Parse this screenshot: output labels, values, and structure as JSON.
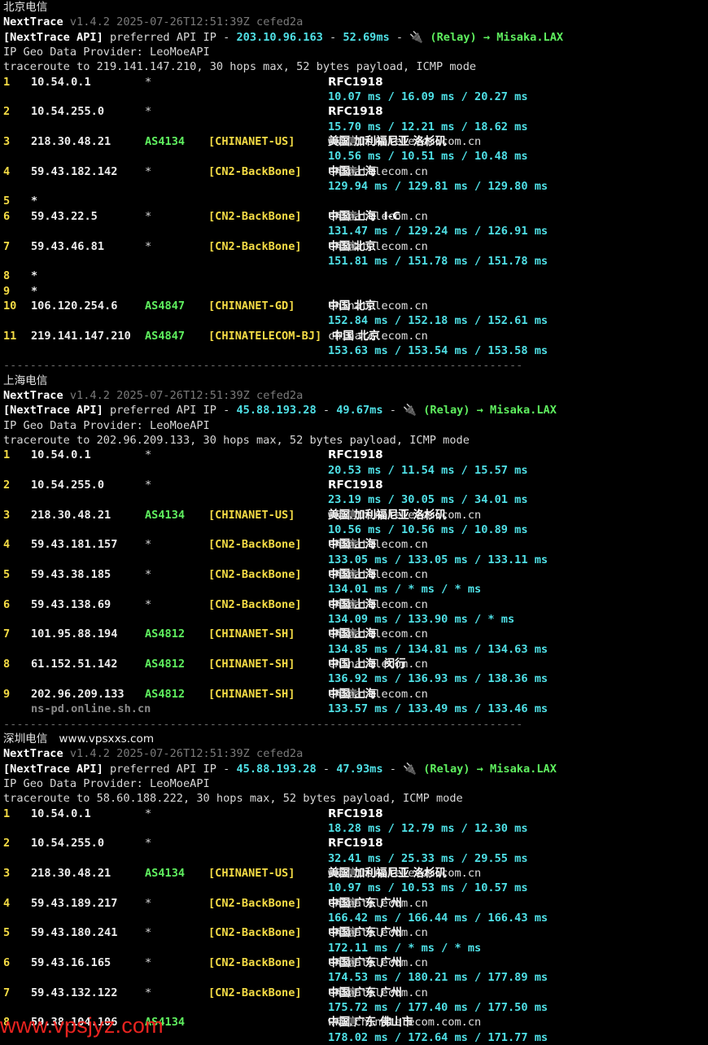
{
  "sections": [
    {
      "title": "北京电信",
      "site": "",
      "version_line": {
        "name": "NextTrace",
        "version": "v1.4.2 2025-07-26T12:51:39Z cefed2a"
      },
      "api_line": {
        "tag": "[NextTrace API]",
        "text1": " preferred API IP - ",
        "ip": "203.10.96.163",
        "dash1": " - ",
        "latency": "52.69ms",
        "dash2": " - ",
        "relay": "🔌 (Relay) → Misaka.LAX"
      },
      "provider_line": "IP Geo Data Provider: LeoMoeAPI",
      "traceroute_line": "traceroute to 219.141.147.210, 30 hops max, 52 bytes payload, ICMP mode",
      "hops": [
        {
          "num": "1",
          "ip": "10.54.0.1",
          "asn": "*",
          "net": "",
          "geo": "RFC1918",
          "domain": "",
          "isp": "",
          "rtt": "10.07 ms / 16.09 ms / 20.27 ms",
          "host": ""
        },
        {
          "num": "2",
          "ip": "10.54.255.0",
          "asn": "*",
          "net": "",
          "geo": "RFC1918",
          "domain": "",
          "isp": "",
          "rtt": "15.70 ms / 12.21 ms / 18.62 ms",
          "host": ""
        },
        {
          "num": "3",
          "ip": "218.30.48.21",
          "asn": "AS4134",
          "net": "[CHINANET-US]",
          "geo": "美国 加利福尼亚 洛杉矶  ",
          "domain": "www.chinatelecom.com.cn",
          "isp": "  电信",
          "rtt": "10.56 ms / 10.51 ms / 10.48 ms",
          "host": ""
        },
        {
          "num": "4",
          "ip": "59.43.182.142",
          "asn": "*",
          "net": "[CN2-BackBone]",
          "geo": "中国 上海    ",
          "domain": "chinatelecom.cn",
          "isp": "  电信",
          "rtt": "129.94 ms / 129.81 ms / 129.80 ms",
          "host": ""
        },
        {
          "num": "5",
          "ip": "*",
          "asn": "",
          "net": "",
          "geo": "",
          "domain": "",
          "isp": "",
          "rtt": "",
          "host": ""
        },
        {
          "num": "6",
          "ip": "59.43.22.5",
          "asn": "*",
          "net": "[CN2-BackBone]",
          "geo": "中国 上海  I-C ",
          "domain": "chinatelecom.cn",
          "isp": "  电信",
          "rtt": "131.47 ms / 129.24 ms / 126.91 ms",
          "host": ""
        },
        {
          "num": "7",
          "ip": "59.43.46.81",
          "asn": "*",
          "net": "[CN2-BackBone]",
          "geo": "中国 北京    ",
          "domain": "chinatelecom.cn",
          "isp": "  电信",
          "rtt": "151.81 ms / 151.78 ms / 151.78 ms",
          "host": ""
        },
        {
          "num": "8",
          "ip": "*",
          "asn": "",
          "net": "",
          "geo": "",
          "domain": "",
          "isp": "",
          "rtt": "",
          "host": ""
        },
        {
          "num": "9",
          "ip": "*",
          "asn": "",
          "net": "",
          "geo": "",
          "domain": "",
          "isp": "",
          "rtt": "",
          "host": ""
        },
        {
          "num": "10",
          "ip": "106.120.254.6",
          "asn": "AS4847",
          "net": "[CHINANET-GD]",
          "geo": "中国 北京    ",
          "domain": "chinatelecom.cn",
          "isp": "",
          "rtt": "152.84 ms / 152.18 ms / 152.61 ms",
          "host": ""
        },
        {
          "num": "11",
          "ip": "219.141.147.210",
          "asn": "AS4847",
          "net": "[CHINATELECOM-BJ]",
          "geo": " 中国 北京    ",
          "domain": "chinatelecom.cn",
          "isp": "",
          "rtt": "153.63 ms / 153.54 ms / 153.58 ms",
          "host": ""
        }
      ]
    },
    {
      "title": "上海电信",
      "site": "",
      "version_line": {
        "name": "NextTrace",
        "version": "v1.4.2 2025-07-26T12:51:39Z cefed2a"
      },
      "api_line": {
        "tag": "[NextTrace API]",
        "text1": " preferred API IP - ",
        "ip": "45.88.193.28",
        "dash1": " - ",
        "latency": "49.67ms",
        "dash2": " - ",
        "relay": "🔌 (Relay) → Misaka.LAX"
      },
      "provider_line": "IP Geo Data Provider: LeoMoeAPI",
      "traceroute_line": "traceroute to 202.96.209.133, 30 hops max, 52 bytes payload, ICMP mode",
      "hops": [
        {
          "num": "1",
          "ip": "10.54.0.1",
          "asn": "*",
          "net": "",
          "geo": "RFC1918",
          "domain": "",
          "isp": "",
          "rtt": "20.53 ms / 11.54 ms / 15.57 ms",
          "host": ""
        },
        {
          "num": "2",
          "ip": "10.54.255.0",
          "asn": "*",
          "net": "",
          "geo": "RFC1918",
          "domain": "",
          "isp": "",
          "rtt": "23.19 ms / 30.05 ms / 34.01 ms",
          "host": ""
        },
        {
          "num": "3",
          "ip": "218.30.48.21",
          "asn": "AS4134",
          "net": "[CHINANET-US]",
          "geo": "美国 加利福尼亚 洛杉矶  ",
          "domain": "www.chinatelecom.com.cn",
          "isp": "  电信",
          "rtt": "10.56 ms / 10.56 ms / 10.89 ms",
          "host": ""
        },
        {
          "num": "4",
          "ip": "59.43.181.157",
          "asn": "*",
          "net": "[CN2-BackBone]",
          "geo": "中国 上海    ",
          "domain": "chinatelecom.cn",
          "isp": "  电信",
          "rtt": "133.05 ms / 133.05 ms / 133.11 ms",
          "host": ""
        },
        {
          "num": "5",
          "ip": "59.43.38.185",
          "asn": "*",
          "net": "[CN2-BackBone]",
          "geo": "中国 上海    ",
          "domain": "chinatelecom.cn",
          "isp": "  电信",
          "rtt": "134.01 ms / * ms / * ms",
          "host": ""
        },
        {
          "num": "6",
          "ip": "59.43.138.69",
          "asn": "*",
          "net": "[CN2-BackBone]",
          "geo": "中国 上海    ",
          "domain": "chinatelecom.cn",
          "isp": "  电信",
          "rtt": "134.09 ms / 133.90 ms / * ms",
          "host": ""
        },
        {
          "num": "7",
          "ip": "101.95.88.194",
          "asn": "AS4812",
          "net": "[CHINANET-SH]",
          "geo": "中国 上海    ",
          "domain": "chinatelecom.cn",
          "isp": "  电信",
          "rtt": "134.85 ms / 134.81 ms / 134.63 ms",
          "host": ""
        },
        {
          "num": "8",
          "ip": "61.152.51.142",
          "asn": "AS4812",
          "net": "[CHINANET-SH]",
          "geo": "中国 上海  闵行 ",
          "domain": "chinatelecom.cn",
          "isp": "",
          "rtt": "136.92 ms / 136.93 ms / 138.36 ms",
          "host": ""
        },
        {
          "num": "9",
          "ip": "202.96.209.133",
          "asn": "AS4812",
          "net": "[CHINANET-SH]",
          "geo": "中国 上海    ",
          "domain": "chinatelecom.cn",
          "isp": "  电信",
          "rtt": "133.57 ms / 133.49 ms / 133.46 ms",
          "host": "ns-pd.online.sh.cn"
        }
      ]
    },
    {
      "title": "深圳电信",
      "site": "www.vpsxxs.com",
      "version_line": {
        "name": "NextTrace",
        "version": "v1.4.2 2025-07-26T12:51:39Z cefed2a"
      },
      "api_line": {
        "tag": "[NextTrace API]",
        "text1": " preferred API IP - ",
        "ip": "45.88.193.28",
        "dash1": " - ",
        "latency": "47.93ms",
        "dash2": " - ",
        "relay": "🔌 (Relay) → Misaka.LAX"
      },
      "provider_line": "IP Geo Data Provider: LeoMoeAPI",
      "traceroute_line": "traceroute to 58.60.188.222, 30 hops max, 52 bytes payload, ICMP mode",
      "hops": [
        {
          "num": "1",
          "ip": "10.54.0.1",
          "asn": "*",
          "net": "",
          "geo": "RFC1918",
          "domain": "",
          "isp": "",
          "rtt": "18.28 ms / 12.79 ms / 12.30 ms",
          "host": ""
        },
        {
          "num": "2",
          "ip": "10.54.255.0",
          "asn": "*",
          "net": "",
          "geo": "RFC1918",
          "domain": "",
          "isp": "",
          "rtt": "32.41 ms / 25.33 ms / 29.55 ms",
          "host": ""
        },
        {
          "num": "3",
          "ip": "218.30.48.21",
          "asn": "AS4134",
          "net": "[CHINANET-US]",
          "geo": "美国 加利福尼亚 洛杉矶  ",
          "domain": "www.chinatelecom.com.cn",
          "isp": "  电信",
          "rtt": "10.97 ms / 10.53 ms / 10.57 ms",
          "host": ""
        },
        {
          "num": "4",
          "ip": "59.43.189.217",
          "asn": "*",
          "net": "[CN2-BackBone]",
          "geo": "中国 广东 广州  ",
          "domain": "chinatelecom.cn",
          "isp": "  电信",
          "rtt": "166.42 ms / 166.44 ms / 166.43 ms",
          "host": ""
        },
        {
          "num": "5",
          "ip": "59.43.180.241",
          "asn": "*",
          "net": "[CN2-BackBone]",
          "geo": "中国 广东 广州  ",
          "domain": "chinatelecom.cn",
          "isp": "  电信",
          "rtt": "172.11 ms / * ms / * ms",
          "host": ""
        },
        {
          "num": "6",
          "ip": "59.43.16.165",
          "asn": "*",
          "net": "[CN2-BackBone]",
          "geo": "中国 广东 广州  ",
          "domain": "chinatelecom.cn",
          "isp": "  电信",
          "rtt": "174.53 ms / 180.21 ms / 177.89 ms",
          "host": ""
        },
        {
          "num": "7",
          "ip": "59.43.132.122",
          "asn": "*",
          "net": "[CN2-BackBone]",
          "geo": "中国 广东 广州  ",
          "domain": "chinatelecom.cn",
          "isp": "  电信",
          "rtt": "175.72 ms / 177.40 ms / 177.50 ms",
          "host": ""
        },
        {
          "num": "8",
          "ip": "59.38.104.106",
          "asn": "AS4134",
          "net": "",
          "geo": "中国 广东 佛山市  ",
          "domain": "www.chinatelecom.com.cn",
          "isp": "  电信",
          "rtt": "178.02 ms / 172.64 ms / 171.77 ms",
          "host": ""
        }
      ]
    }
  ],
  "separator": "------------------------------------------------------------------------------",
  "watermark": "www.vpsjyz.com"
}
